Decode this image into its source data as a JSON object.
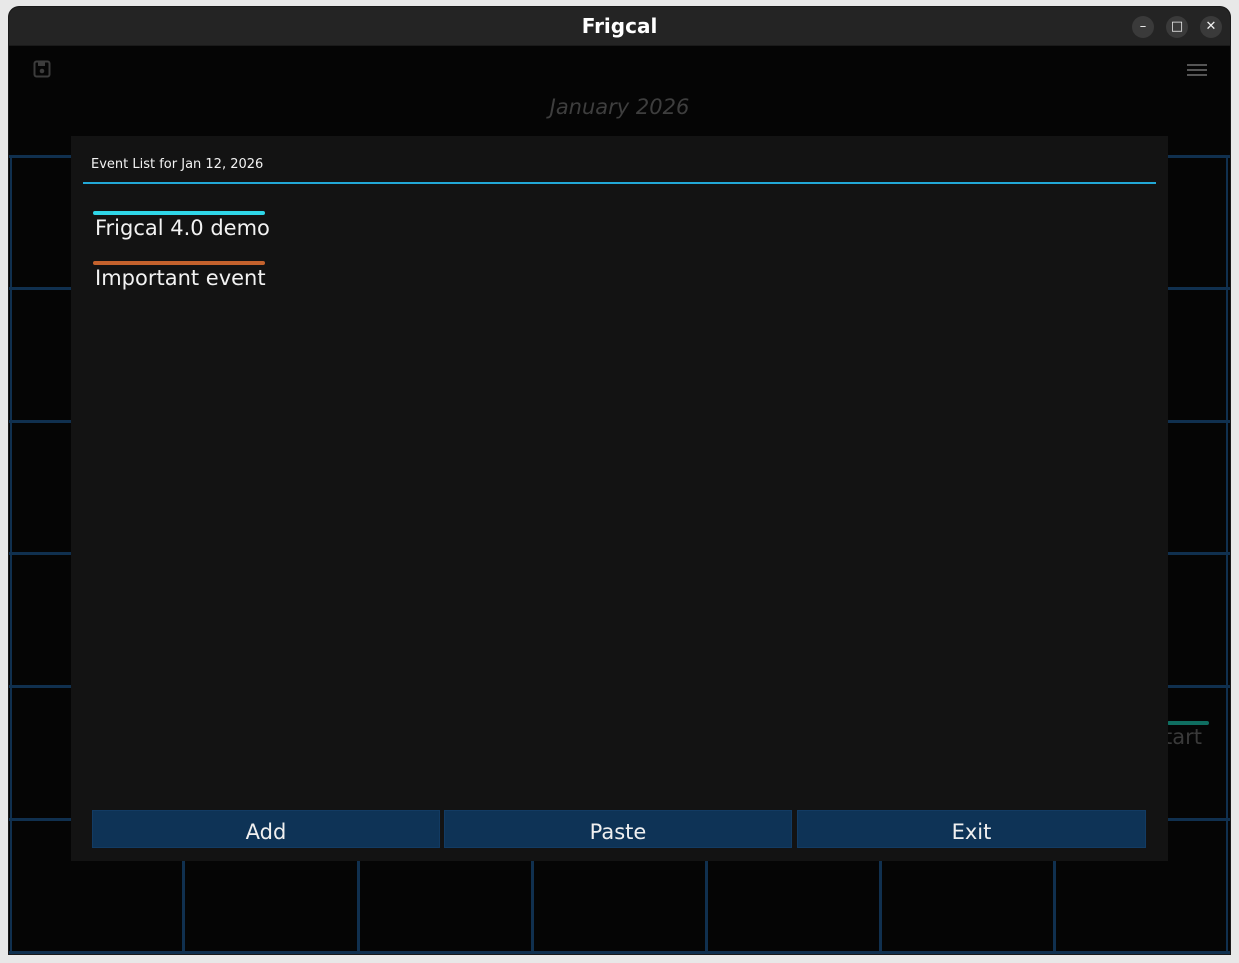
{
  "window": {
    "title": "Frigcal",
    "controls": {
      "minimize": "–",
      "maximize": "□",
      "close": "✕"
    }
  },
  "toolbar": {
    "left_icon": "save-icon",
    "right_icon": "hamburger-menu-icon"
  },
  "calendar": {
    "month_title": "January 2026",
    "partial_event_text": "tart",
    "partial_event_color": "#0f6e61"
  },
  "dialog": {
    "title": "Event List for Jan 12, 2026",
    "accent_color": "#22a8d6",
    "events": [
      {
        "label": "Frigcal 4.0 demo",
        "color": "#2fd6e8"
      },
      {
        "label": "Important event",
        "color": "#c4622d"
      }
    ],
    "buttons": {
      "add": "Add",
      "paste": "Paste",
      "exit": "Exit"
    }
  }
}
